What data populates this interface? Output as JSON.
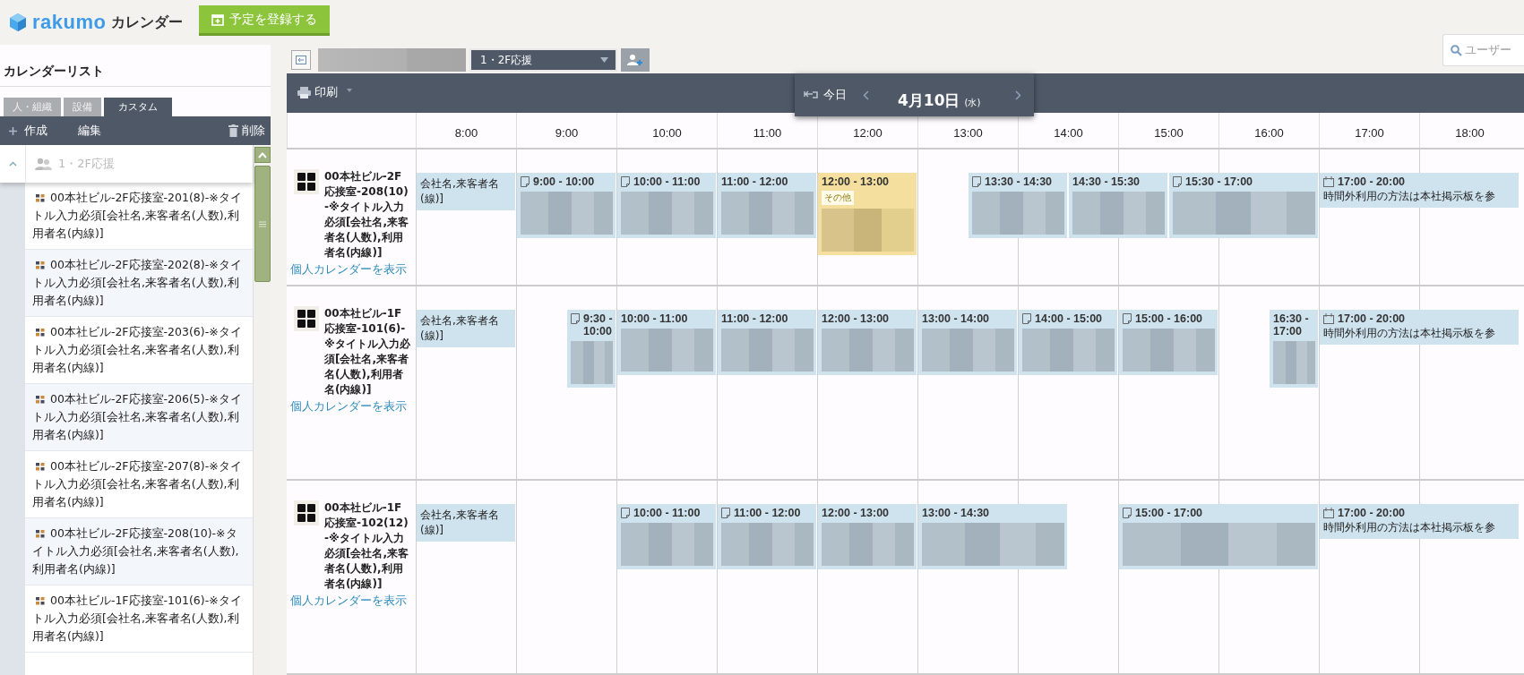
{
  "app": {
    "logo": "rakumo",
    "product": "カレンダー",
    "new_event_button": "予定を登録する",
    "search": {
      "placeholder": "ユーザー"
    }
  },
  "sidebar": {
    "title": "カレンダーリスト",
    "tabs": [
      {
        "label": "人・組織",
        "selected": false
      },
      {
        "label": "設備",
        "selected": false
      },
      {
        "label": "カスタム",
        "selected": true
      }
    ],
    "actions": [
      {
        "label": "作成",
        "kind": "add"
      },
      {
        "label": "編集",
        "kind": "plain"
      },
      {
        "label": "削除",
        "kind": "delete"
      }
    ],
    "group": {
      "name": "1・2F応援",
      "expanded": true
    },
    "items": [
      "00本社ビル-2F応接室-201(8)-※タイトル入力必須[会社名,来客者名(人数),利用者名(内線)]",
      "00本社ビル-2F応接室-202(8)-※タイトル入力必須[会社名,来客者名(人数),利用者名(内線)]",
      "00本社ビル-2F応接室-203(6)-※タイトル入力必須[会社名,来客者名(人数),利用者名(内線)]",
      "00本社ビル-2F応接室-206(5)-※タイトル入力必須[会社名,来客者名(人数),利用者名(内線)]",
      "00本社ビル-2F応接室-207(8)-※タイトル入力必須[会社名,来客者名(人数),利用者名(内線)]",
      "00本社ビル-2F応接室-208(10)-※タイトル入力必須[会社名,来客者名(人数),利用者名(内線)]",
      "00本社ビル-1F応接室-101(6)-※タイトル入力必須[会社名,来客者名(人数),利用者名(内線)]"
    ]
  },
  "toolbar": {
    "calendar_select": "1・2F応援",
    "print": "印刷",
    "today": "今日",
    "date": "4月10日",
    "weekday": "(水)"
  },
  "timeline": {
    "hours": [
      "8:00",
      "9:00",
      "10:00",
      "11:00",
      "12:00",
      "13:00",
      "14:00",
      "15:00",
      "16:00",
      "17:00",
      "18:00"
    ],
    "rows": [
      {
        "name": "00本社ビル-2F応接室-208(10)-※タイトル入力必須[会社名,来客者名(人数),利用者名(内線)]",
        "link": "個人カレンダーを表示",
        "events": [
          {
            "kind": "continued",
            "text": "会社名,来客者名(線)]",
            "color": "#cfe3ef"
          },
          {
            "kind": "note",
            "time": "9:00 - 10:00",
            "color": "#cfe3ef"
          },
          {
            "kind": "note",
            "time": "10:00 - 11:00",
            "color": "#cfe3ef"
          },
          {
            "kind": "timed",
            "time": "11:00 - 12:00",
            "color": "#cfe3ef"
          },
          {
            "kind": "timed",
            "time": "12:00 - 13:00",
            "tag": "その他",
            "color": "#f4df9e"
          },
          {
            "kind": "note",
            "time": "13:30 - 14:30",
            "color": "#cfe3ef"
          },
          {
            "kind": "timed",
            "time": "14:30 - 15:30",
            "color": "#cfe3ef"
          },
          {
            "kind": "note",
            "time": "15:30 - 17:00",
            "color": "#cfe3ef"
          },
          {
            "kind": "schedule",
            "time": "17:00 - 20:00",
            "text": "時間外利用の方法は本社掲示板を参",
            "color": "#cfe3ef"
          }
        ]
      },
      {
        "name": "00本社ビル-1F応接室-101(6)-※タイトル入力必須[会社名,来客者名(人数),利用者名(内線)]",
        "link": "個人カレンダーを表示",
        "events": [
          {
            "kind": "continued",
            "text": "会社名,来客者名(線)]",
            "color": "#cfe3ef"
          },
          {
            "kind": "note",
            "time": "9:30 - 10:00",
            "color": "#cfe3ef"
          },
          {
            "kind": "timed",
            "time": "10:00 - 11:00",
            "color": "#cfe3ef"
          },
          {
            "kind": "timed",
            "time": "11:00 - 12:00",
            "color": "#cfe3ef"
          },
          {
            "kind": "timed",
            "time": "12:00 - 13:00",
            "color": "#cfe3ef"
          },
          {
            "kind": "timed",
            "time": "13:00 - 14:00",
            "color": "#cfe3ef"
          },
          {
            "kind": "note",
            "time": "14:00 - 15:00",
            "color": "#cfe3ef"
          },
          {
            "kind": "note",
            "time": "15:00 - 16:00",
            "color": "#cfe3ef"
          },
          {
            "kind": "timed",
            "time": "16:30 - 17:00",
            "color": "#cfe3ef"
          },
          {
            "kind": "schedule",
            "time": "17:00 - 20:00",
            "text": "時間外利用の方法は本社掲示板を参",
            "color": "#cfe3ef"
          }
        ]
      },
      {
        "name": "00本社ビル-1F応接室-102(12)-※タイトル入力必須[会社名,来客者名(人数),利用者名(内線)]",
        "link": "個人カレンダーを表示",
        "events": [
          {
            "kind": "continued",
            "text": "会社名,来客者名(線)]",
            "color": "#cfe3ef"
          },
          {
            "kind": "note",
            "time": "10:00 - 11:00",
            "color": "#cfe3ef"
          },
          {
            "kind": "note",
            "time": "11:00 - 12:00",
            "color": "#cfe3ef"
          },
          {
            "kind": "timed",
            "time": "12:00 - 13:00",
            "color": "#cfe3ef"
          },
          {
            "kind": "timed",
            "time": "13:00 - 14:30",
            "color": "#cfe3ef"
          },
          {
            "kind": "note",
            "time": "15:00 - 17:00",
            "color": "#cfe3ef"
          },
          {
            "kind": "schedule",
            "time": "17:00 - 20:00",
            "text": "時間外利用の方法は本社掲示板を参",
            "color": "#cfe3ef"
          }
        ]
      }
    ]
  }
}
